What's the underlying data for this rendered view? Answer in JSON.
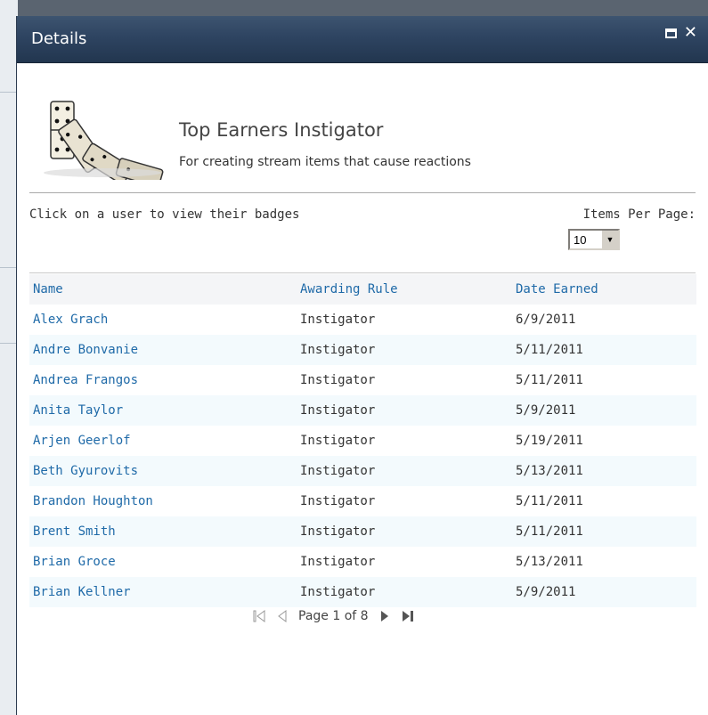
{
  "dialog": {
    "title": "Details"
  },
  "badge": {
    "name": "Top Earners Instigator",
    "description": "For creating stream items that cause reactions",
    "image_icon": "dominoes-icon"
  },
  "instructions": "Click on a user to view their badges",
  "items_per_page": {
    "label": "Items Per Page:",
    "selected": "10"
  },
  "table": {
    "headers": [
      "Name",
      "Awarding Rule",
      "Date Earned"
    ],
    "rows": [
      {
        "name": "Alex Grach",
        "rule": "Instigator",
        "date": "6/9/2011"
      },
      {
        "name": "Andre Bonvanie",
        "rule": "Instigator",
        "date": "5/11/2011"
      },
      {
        "name": "Andrea Frangos",
        "rule": "Instigator",
        "date": "5/11/2011"
      },
      {
        "name": "Anita Taylor",
        "rule": "Instigator",
        "date": "5/9/2011"
      },
      {
        "name": "Arjen Geerlof",
        "rule": "Instigator",
        "date": "5/19/2011"
      },
      {
        "name": "Beth Gyurovits",
        "rule": "Instigator",
        "date": "5/13/2011"
      },
      {
        "name": "Brandon Houghton",
        "rule": "Instigator",
        "date": "5/11/2011"
      },
      {
        "name": "Brent Smith",
        "rule": "Instigator",
        "date": "5/11/2011"
      },
      {
        "name": "Brian Groce",
        "rule": "Instigator",
        "date": "5/13/2011"
      },
      {
        "name": "Brian Kellner",
        "rule": "Instigator",
        "date": "5/9/2011"
      }
    ]
  },
  "pager": {
    "text": "Page 1 of 8"
  },
  "colors": {
    "link": "#1f6aa8",
    "titlebar": "#2e4461"
  }
}
